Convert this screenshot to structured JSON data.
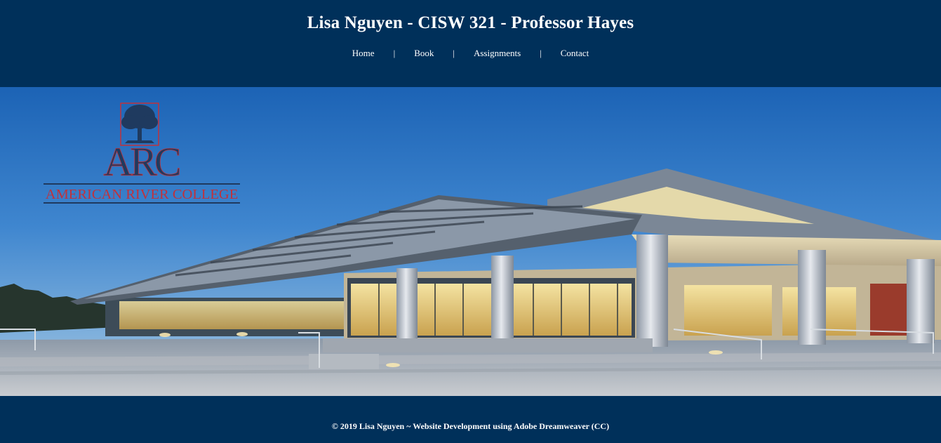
{
  "header": {
    "title": "Lisa Nguyen - CISW 321 - Professor Hayes"
  },
  "nav": {
    "items": [
      {
        "label": "Home"
      },
      {
        "label": "Book"
      },
      {
        "label": "Assignments"
      },
      {
        "label": "Contact"
      }
    ],
    "separator": "|"
  },
  "hero": {
    "logo": {
      "monogram": "ARC",
      "name": "AMERICAN RIVER COLLEGE",
      "icon": "tree-icon"
    }
  },
  "footer": {
    "copyright": "© 2019 Lisa Nguyen ~ Website Development using Adobe Dreamweaver (CC)"
  },
  "colors": {
    "background": "#00305a",
    "text": "#ffffff",
    "logo_navy": "#1f3a5f",
    "logo_red": "#c0323c"
  }
}
